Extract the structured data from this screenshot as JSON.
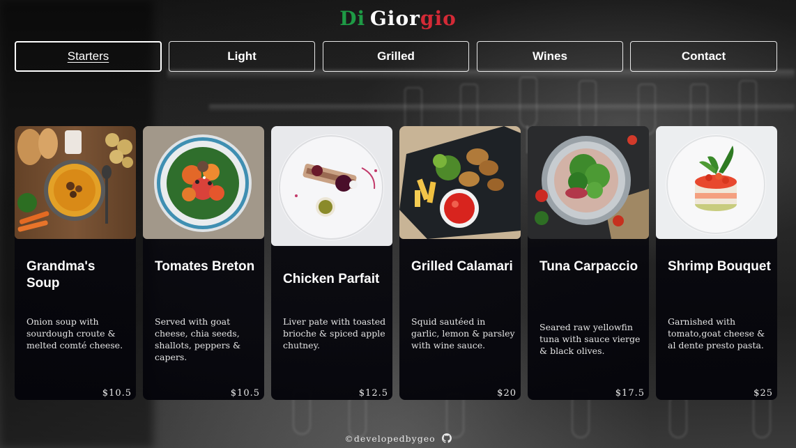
{
  "brand": {
    "part1": "Di",
    "part2": "Gior",
    "part3": "gio",
    "colors": {
      "green": "#1e9a45",
      "white": "#ffffff",
      "red": "#d42a36"
    }
  },
  "nav": {
    "items": [
      {
        "label": "Starters",
        "active": true
      },
      {
        "label": "Light",
        "active": false
      },
      {
        "label": "Grilled",
        "active": false
      },
      {
        "label": "Wines",
        "active": false
      },
      {
        "label": "Contact",
        "active": false
      }
    ]
  },
  "menu": {
    "items": [
      {
        "title": "Grandma's Soup",
        "description": "Onion soup with sourdough croute & melted comté cheese.",
        "price": "$10.5",
        "image": "soup-image"
      },
      {
        "title": "Tomates Breton",
        "description": "Served with goat cheese, chia seeds, shallots, peppers & capers.",
        "price": "$10.5",
        "image": "salad-image"
      },
      {
        "title": "Chicken Parfait",
        "description": "Liver pate with toasted brioche & spiced apple chutney.",
        "price": "$12.5",
        "image": "parfait-image"
      },
      {
        "title": "Grilled Calamari",
        "description": "Squid sautéed in garlic, lemon & parsley with wine sauce.",
        "price": "$20",
        "image": "calamari-image"
      },
      {
        "title": "Tuna Carpaccio",
        "description": "Seared raw yellowfin tuna with sauce vierge & black olives.",
        "price": "$17.5",
        "image": "carpaccio-image"
      },
      {
        "title": "Shrimp Bouquet",
        "description": "Garnished with tomato,goat cheese & al dente presto pasta.",
        "price": "$25",
        "image": "shrimp-image"
      }
    ]
  },
  "footer": {
    "text": "©developedbygeo",
    "icon": "github-icon"
  }
}
